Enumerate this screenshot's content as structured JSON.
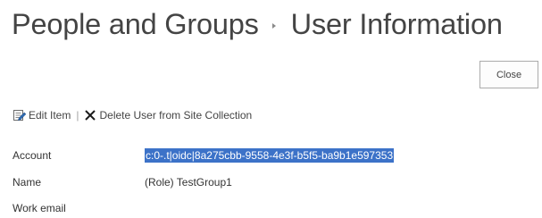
{
  "header": {
    "title_part1": "People and Groups",
    "title_part2": "User Information"
  },
  "actions": {
    "close_label": "Close"
  },
  "toolbar": {
    "edit_item_label": "Edit Item",
    "separator": "|",
    "delete_user_label": "Delete User from Site Collection",
    "edit_icon": "edit-item-icon",
    "delete_icon": "delete-x-icon"
  },
  "fields": [
    {
      "label": "Account",
      "value": "c:0-.t|oidc|8a275cbb-9558-4e3f-b5f5-ba9b1e597353",
      "selected": true
    },
    {
      "label": "Name",
      "value": "(Role) TestGroup1"
    },
    {
      "label": "Work email",
      "value": ""
    }
  ],
  "colors": {
    "selection_background": "#3c72c8",
    "delete_icon": "#1a1a1a",
    "edit_icon_accent": "#2f6db5"
  }
}
